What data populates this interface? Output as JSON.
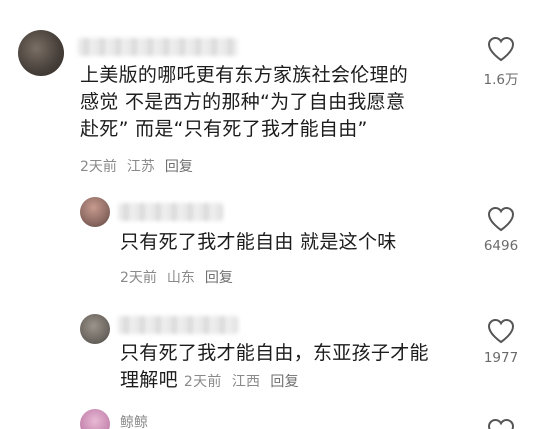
{
  "comments": [
    {
      "text_lines": [
        "上美版的哪吒更有东方家族社会伦理的",
        "感觉 不是西方的那种“为了自由我愿意",
        "赴死” 而是“只有死了我才能自由”"
      ],
      "time": "2天前",
      "location": "江苏",
      "reply_label": "回复",
      "likes": "1.6万"
    },
    {
      "text_lines": [
        "只有死了我才能自由 就是这个味"
      ],
      "time": "2天前",
      "location": "山东",
      "reply_label": "回复",
      "likes": "6496"
    },
    {
      "text_lines": [
        "只有死了我才能自由，东亚孩子才能",
        "理解吧"
      ],
      "time": "2天前",
      "location": "江西",
      "reply_label": "回复",
      "likes": "1977"
    },
    {
      "username": "鲸鲸"
    }
  ]
}
